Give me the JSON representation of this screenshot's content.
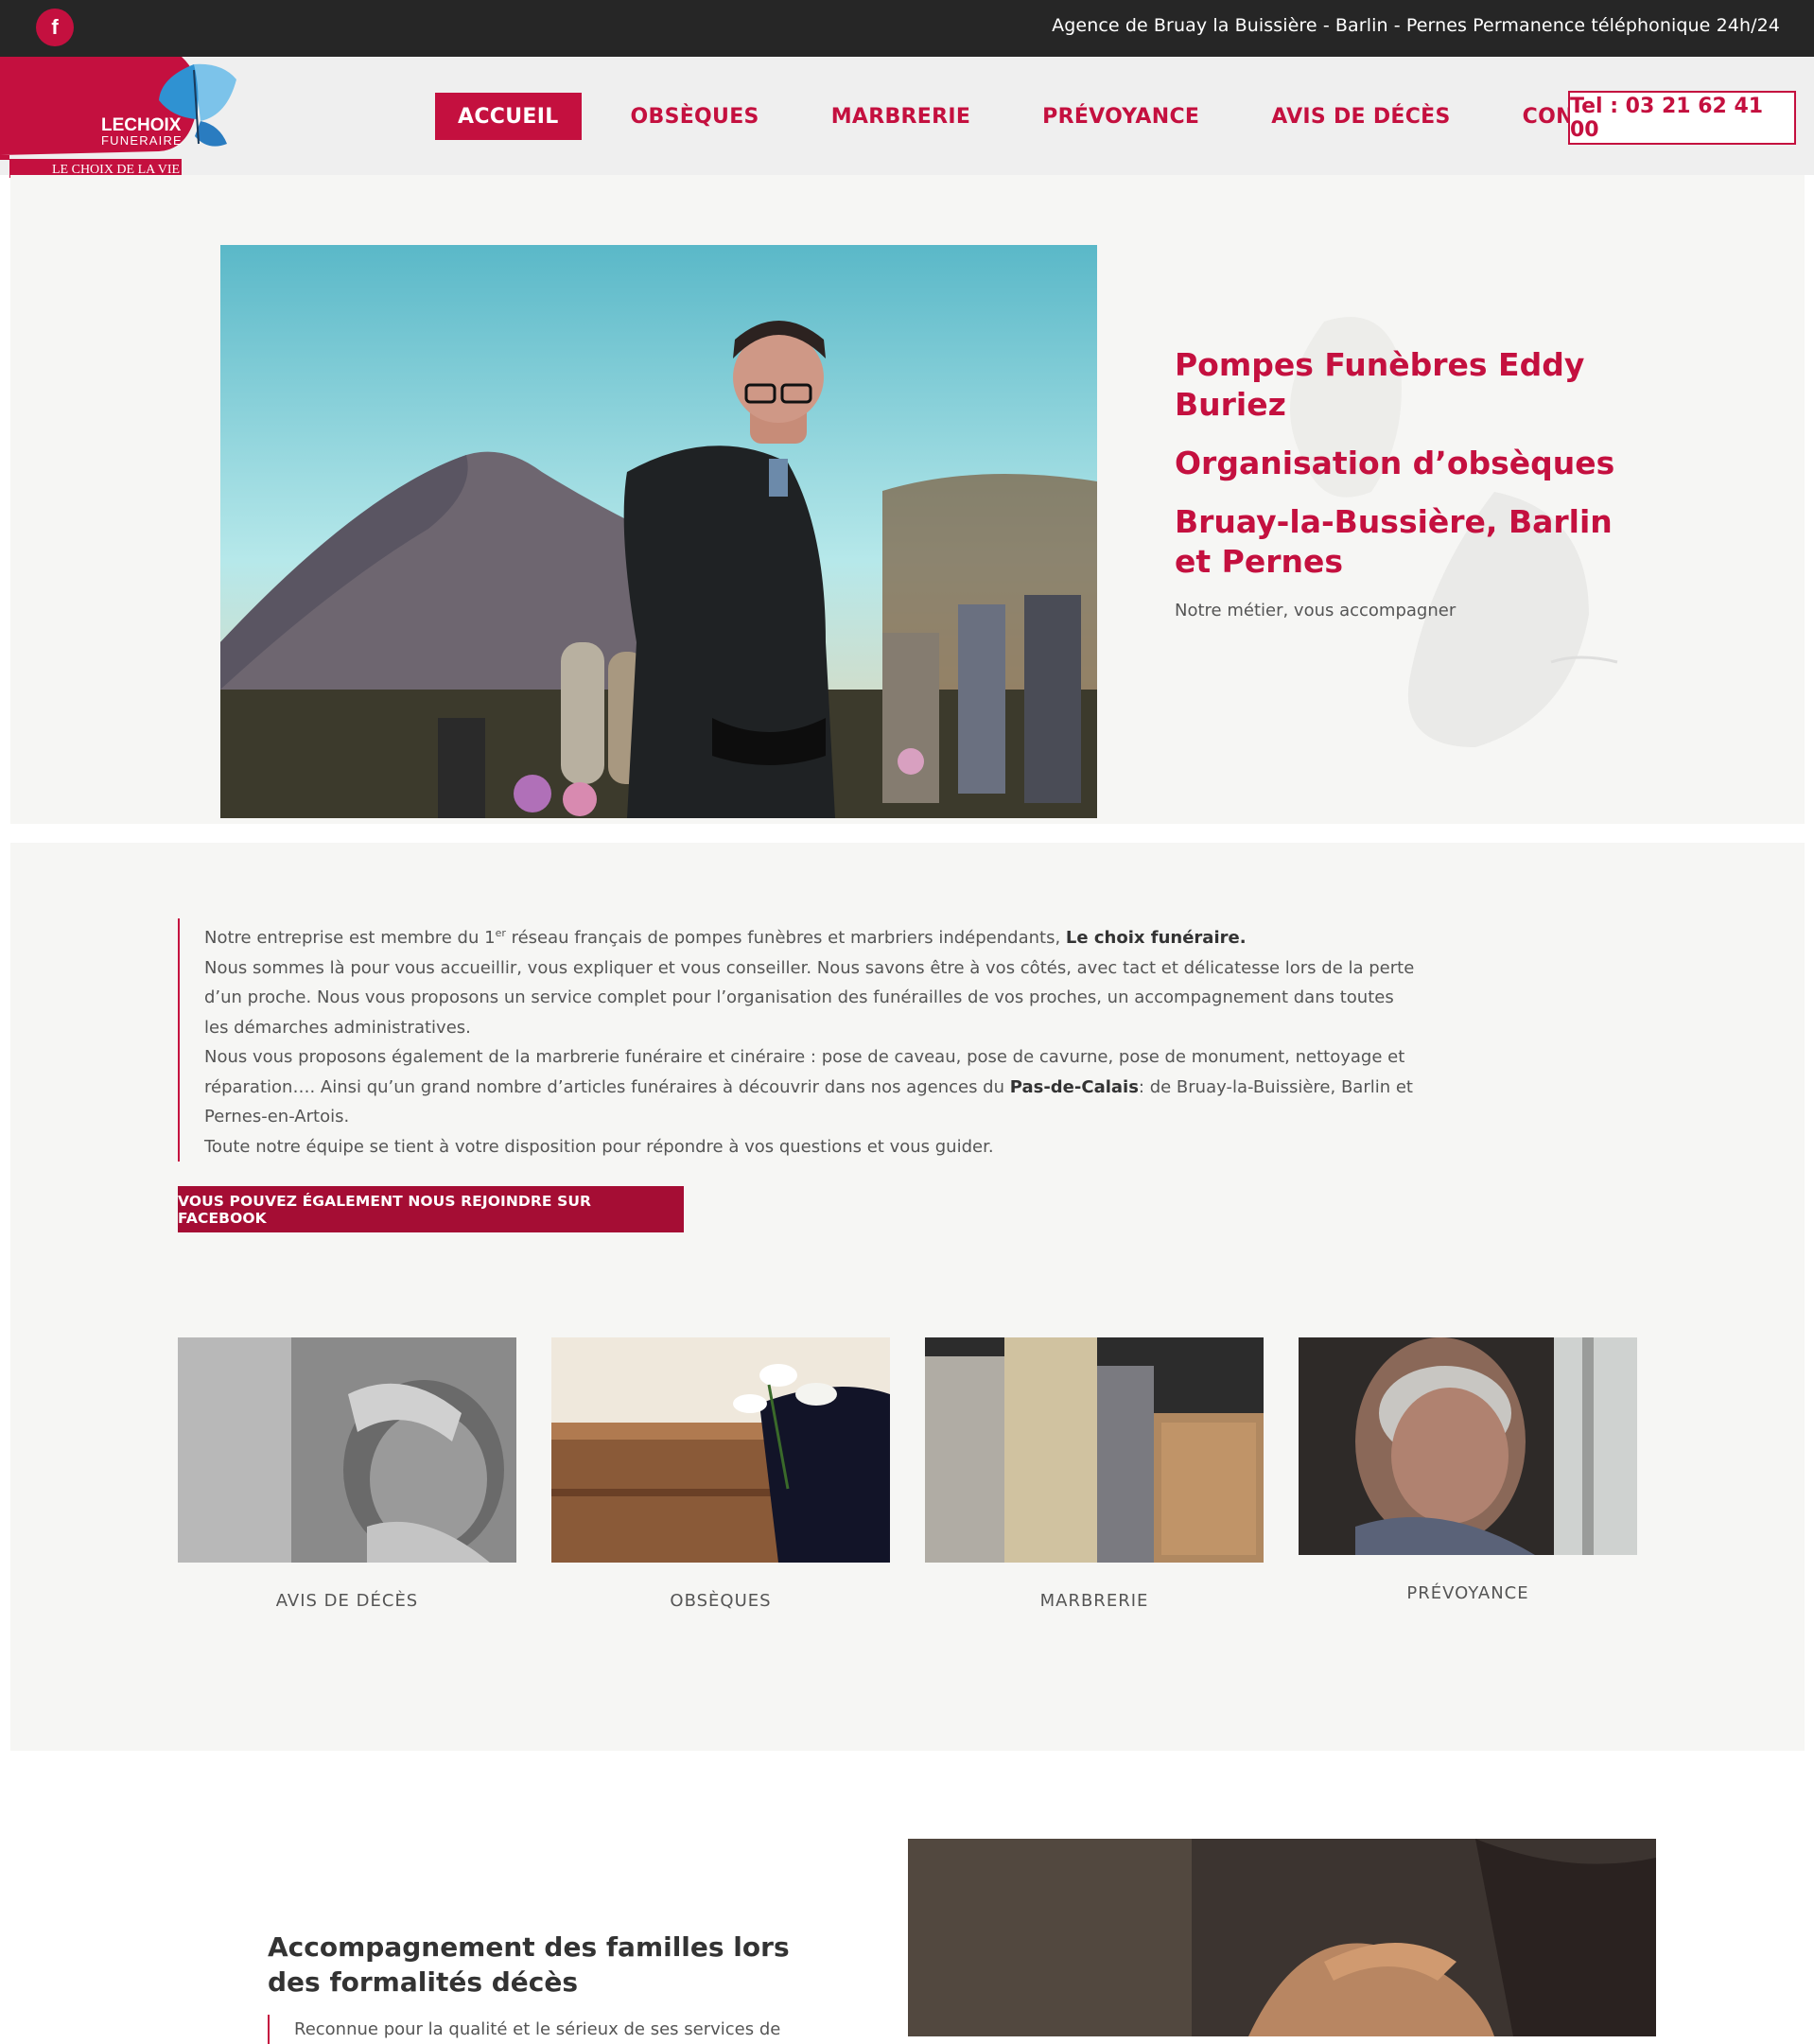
{
  "topbar": {
    "facebook_icon_glyph": "f",
    "agency_info": "Agence de Bruay la Buissière - Barlin - Pernes Permanence téléphonique 24h/24"
  },
  "logo": {
    "text_top": "LECHOIX",
    "text_bottom": "FUNERAIRE",
    "tagline": "LE CHOIX DE LA VIE"
  },
  "nav": {
    "items": [
      {
        "label": "ACCUEIL",
        "active": true
      },
      {
        "label": "OBSÈQUES",
        "active": false
      },
      {
        "label": "MARBRERIE",
        "active": false
      },
      {
        "label": "PRÉVOYANCE",
        "active": false
      },
      {
        "label": "AVIS DE DÉCÈS",
        "active": false
      },
      {
        "label": "CONTACT",
        "active": false
      }
    ],
    "phone_label": "Tel : 03 21 62 41 00"
  },
  "hero": {
    "title_line1": "Pompes Funèbres Eddy Buriez",
    "title_line2": "Organisation d’obsèques",
    "title_line3": "Bruay-la-Bussière, Barlin et Pernes",
    "subtitle": "Notre métier, vous accompagner"
  },
  "about": {
    "p1_a": "Notre entreprise est membre du 1",
    "p1_sup": "er",
    "p1_b": " réseau français de pompes funèbres et marbriers indépendants, ",
    "p1_bold": "Le choix funéraire.",
    "p2": "Nous sommes là pour vous accueillir, vous expliquer et vous conseiller. Nous savons être à vos côtés, avec tact et délicatesse lors de la perte d’un proche. Nous vous proposons un service complet pour l’organisation des funérailles de vos proches, un accompagnement dans toutes les démarches administratives.",
    "p3_a": "Nous vous proposons également de la marbrerie funéraire et cinéraire : pose de caveau, pose de cavurne, pose de monument, nettoyage et réparation…. Ainsi qu’un grand nombre d’articles funéraires à découvrir dans nos agences du ",
    "p3_bold": "Pas-de-Calais",
    "p3_b": ": de Bruay-la-Buissière, Barlin et Pernes-en-Artois.",
    "p4": "Toute notre équipe se tient à votre disposition pour répondre à vos questions et vous guider.",
    "facebook_button": "VOUS POUVEZ ÉGALEMENT NOUS REJOINDRE SUR FACEBOOK"
  },
  "cards": [
    {
      "label": "AVIS DE DÉCÈS"
    },
    {
      "label": "OBSÈQUES"
    },
    {
      "label": "MARBRERIE"
    },
    {
      "label": "PRÉVOYANCE"
    }
  ],
  "bottom": {
    "title": "Accompagnement des familles lors des formalités décès",
    "text": "Reconnue pour la qualité et le sérieux de ses services de"
  },
  "colors": {
    "brand": "#c4103f",
    "brand_dark": "#a50d34",
    "topbar": "#262626",
    "section_bg": "#f6f6f4"
  }
}
